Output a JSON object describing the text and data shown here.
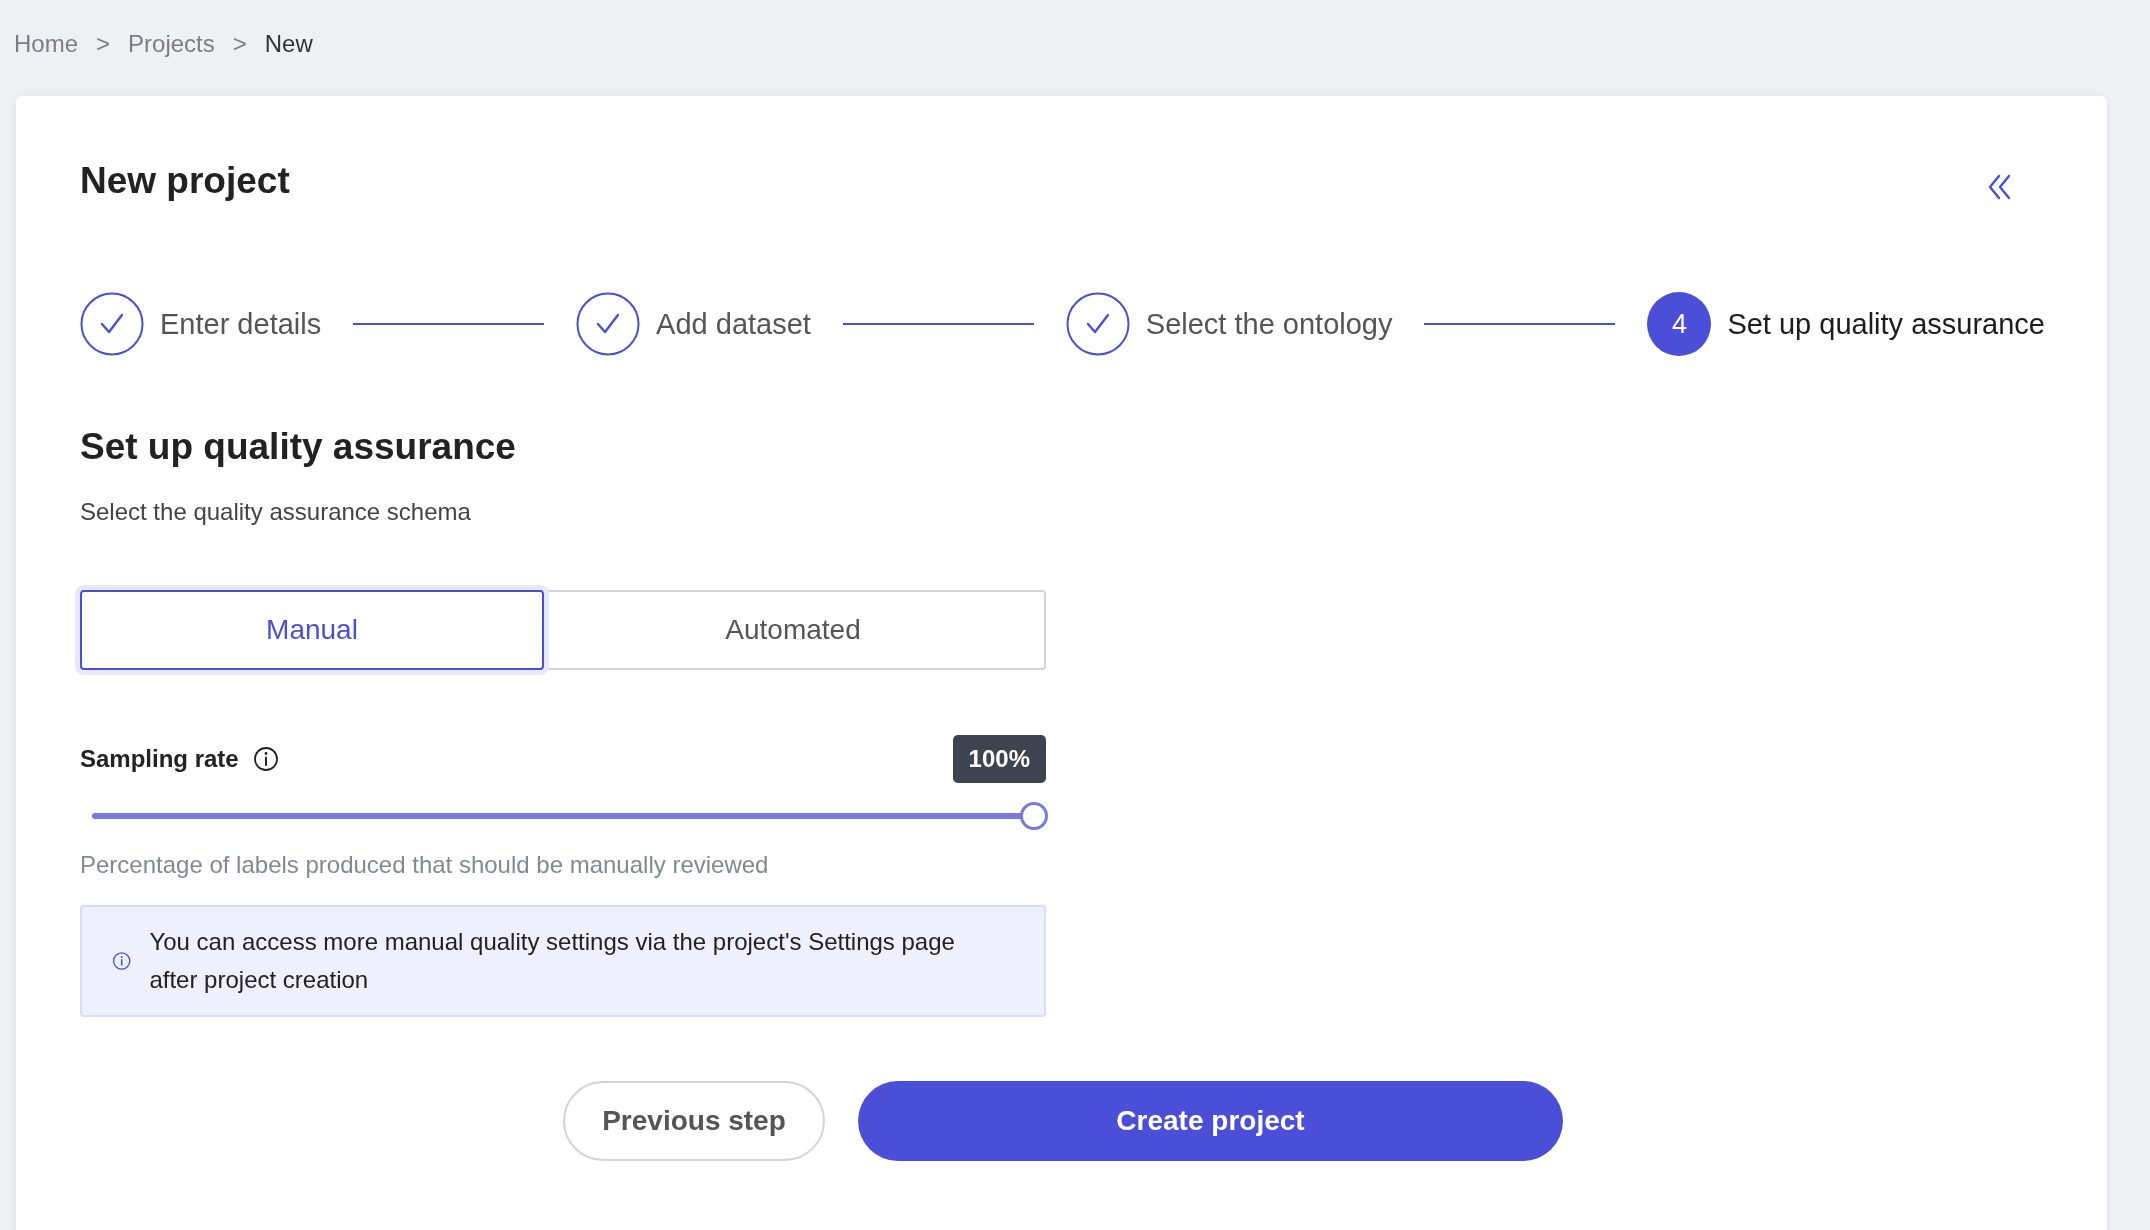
{
  "breadcrumb": [
    {
      "label": "Home",
      "current": false
    },
    {
      "label": "Projects",
      "current": false
    },
    {
      "label": "New",
      "current": true
    }
  ],
  "breadcrumb_separator": ">",
  "title": "New project",
  "steps": [
    {
      "label": "Enter details",
      "done": true
    },
    {
      "label": "Add dataset",
      "done": true
    },
    {
      "label": "Select the ontology",
      "done": true
    },
    {
      "label": "Set up quality assurance",
      "done": false,
      "number": "4"
    }
  ],
  "section": {
    "heading": "Set up quality assurance",
    "subtitle": "Select the quality assurance schema"
  },
  "schema_options": [
    {
      "label": "Manual",
      "selected": true
    },
    {
      "label": "Automated",
      "selected": false
    }
  ],
  "sampling": {
    "label": "Sampling rate",
    "value": "100%",
    "level": 1,
    "hint": "Percentage of labels produced that should be manually reviewed"
  },
  "notice": "You can access more manual quality settings via the project's Settings page after project creation",
  "buttons": [
    {
      "label": "Previous step",
      "kind": "secondary"
    },
    {
      "label": "Create project",
      "kind": "primary"
    }
  ]
}
